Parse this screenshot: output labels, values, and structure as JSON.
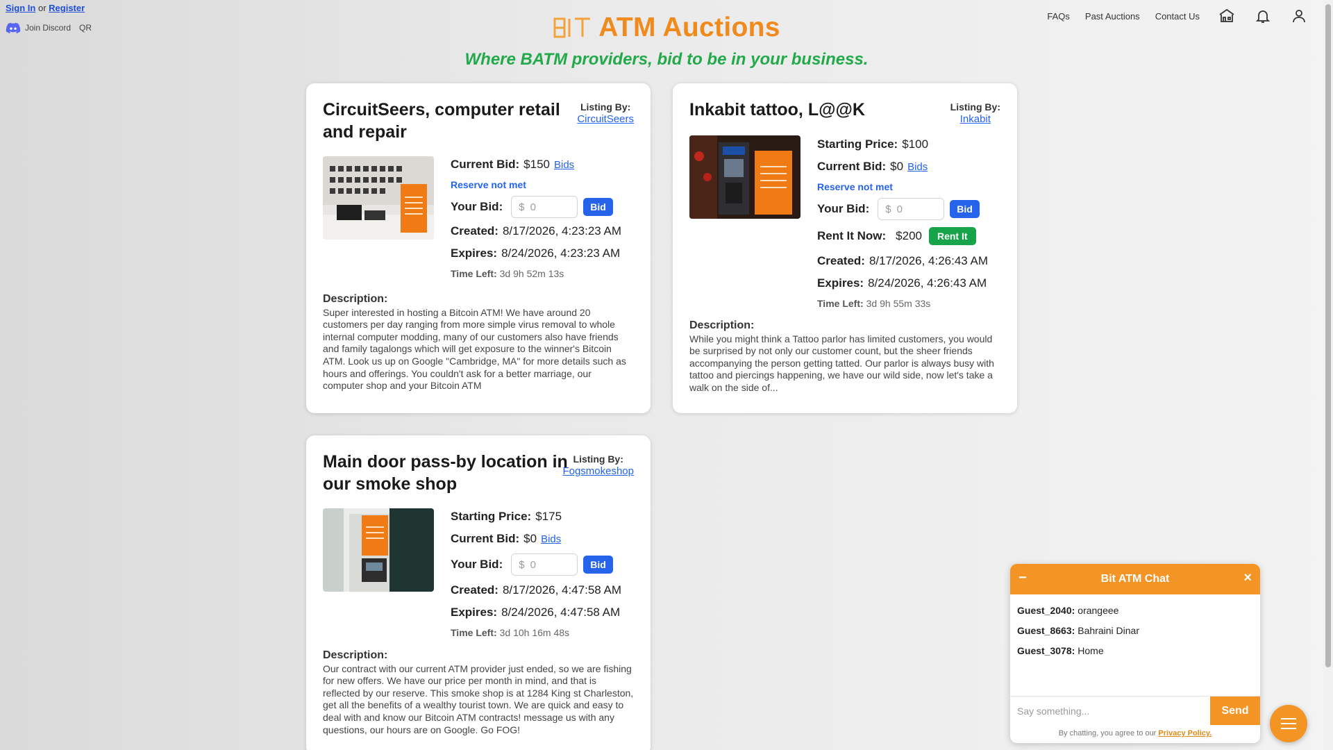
{
  "auth": {
    "signin": "Sign In",
    "or": "or",
    "register": "Register"
  },
  "discord": {
    "label": "Join Discord",
    "qr": "QR"
  },
  "header": {
    "title": "ATM Auctions",
    "tagline": "Where BATM providers, bid to be in your business.",
    "nav": [
      "FAQs",
      "Past Auctions",
      "Contact Us"
    ]
  },
  "colors": {
    "brand_orange": "#f08a1c",
    "tagline_green": "#22a94a",
    "link_blue": "#2563eb",
    "rent_green": "#16a34a"
  },
  "icons": [
    "home-icon",
    "bell-icon",
    "user-icon",
    "discord-icon",
    "menu-icon"
  ],
  "labels": {
    "listing_by": "Listing By:",
    "starting_price": "Starting Price:",
    "current_bid": "Current Bid:",
    "bids": "Bids",
    "reserve": "Reserve not met",
    "your_bid": "Your Bid:",
    "bid_placeholder": "0",
    "bid_btn": "Bid",
    "rent_now": "Rent It Now:",
    "rent_btn": "Rent It",
    "created": "Created:",
    "expires": "Expires:",
    "time_left": "Time Left:",
    "description": "Description:"
  },
  "listings": [
    {
      "title": "CircuitSeers, computer retail and repair",
      "seller": "CircuitSeers",
      "current_bid": "$150",
      "created": "8/17/2026, 4:23:23 AM",
      "expires": "8/24/2026, 4:23:23 AM",
      "time_left": "3d 9h 52m 13s",
      "description": "Super interested in hosting a Bitcoin ATM! We have around 20 customers per day ranging from more simple virus removal to whole internal computer modding, many of our customers also have friends and family tagalongs which will get exposure to the winner's Bitcoin ATM. Look us up on Google \"Cambridge, MA\" for more details such as hours and offerings. You couldn't ask for a better marriage, our computer shop and your Bitcoin ATM"
    },
    {
      "title": "Inkabit tattoo, L@@K",
      "seller": "Inkabit",
      "starting_price": "$100",
      "current_bid": "$0",
      "rent_price": "$200",
      "created": "8/17/2026, 4:26:43 AM",
      "expires": "8/24/2026, 4:26:43 AM",
      "time_left": "3d 9h 55m 33s",
      "description": "While you might think a Tattoo parlor has limited customers, you would be surprised by not only our customer count, but the sheer friends accompanying the person getting tatted. Our parlor is always busy with tattoo and piercings happening, we have our wild side, now let's take a walk on the side of..."
    },
    {
      "title": "Main door pass-by location in our smoke shop",
      "seller": "Fogsmokeshop",
      "starting_price": "$175",
      "current_bid": "$0",
      "created": "8/17/2026, 4:47:58 AM",
      "expires": "8/24/2026, 4:47:58 AM",
      "time_left": "3d 10h 16m 48s",
      "description": "Our contract with our current ATM provider just ended, so we are fishing for new offers. We have our price per month in mind, and that is reflected by our reserve. This smoke shop is at 1284 King st Charleston, get all the benefits of a wealthy tourist town. We are quick and easy to deal with and know our Bitcoin ATM contracts! message us with any questions, our hours are on Google. Go FOG!"
    }
  ],
  "chat": {
    "title": "Bit ATM Chat",
    "minimize": "−",
    "close": "×",
    "messages": [
      {
        "user": "Guest_2040:",
        "text": "orangeee"
      },
      {
        "user": "Guest_8663:",
        "text": "Bahraini Dinar"
      },
      {
        "user": "Guest_3078:",
        "text": "Home"
      }
    ],
    "placeholder": "Say something...",
    "send": "Send",
    "terms": "By chatting, you agree to our",
    "policy": "Privacy Policy."
  }
}
